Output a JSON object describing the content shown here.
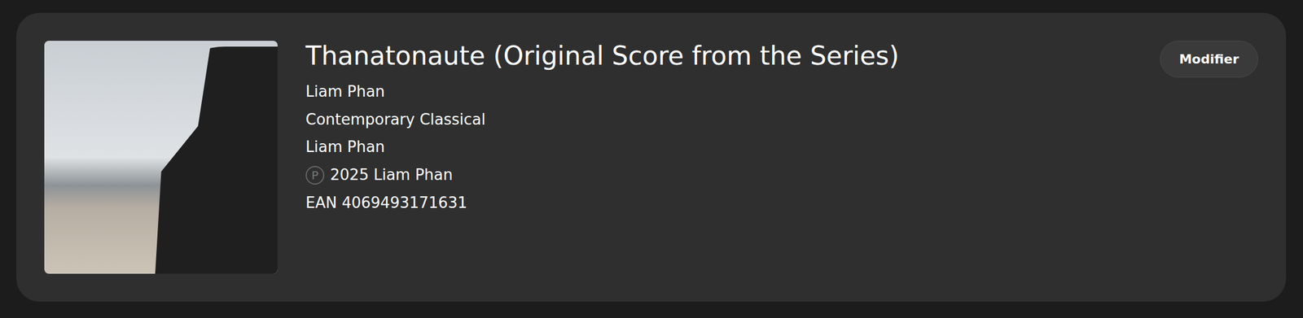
{
  "release": {
    "title": "Thanatonaute (Original Score from the Series)",
    "lines": [
      {
        "kind": "text",
        "text": "Liam Phan"
      },
      {
        "kind": "text",
        "text": "Contemporary Classical"
      },
      {
        "kind": "text",
        "text": "Liam Phan"
      },
      {
        "kind": "phonogram",
        "symbol": "P",
        "text": "2025 Liam Phan"
      },
      {
        "kind": "text",
        "text": "EAN 4069493171631"
      }
    ]
  },
  "buttons": [
    "Modifier"
  ]
}
